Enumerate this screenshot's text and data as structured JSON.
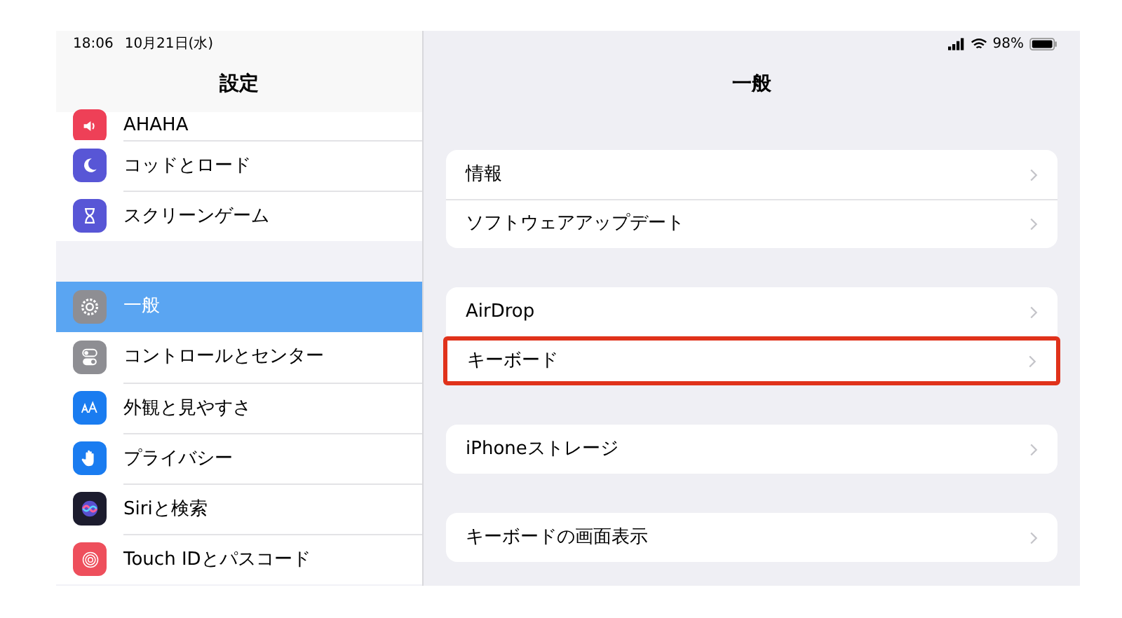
{
  "status_bar": {
    "time": "18:06",
    "date": "10月21日(水)",
    "battery": "98%"
  },
  "sidebar": {
    "title": "設定",
    "sections": [
      {
        "items": [
          {
            "label": "AHAHA",
            "kind": "sound",
            "color": "#ee4057",
            "selected": false
          },
          {
            "label": "コッドとロード",
            "kind": "moon",
            "color": "#5856d6",
            "selected": false
          },
          {
            "label": "スクリーンゲーム",
            "kind": "hourglass",
            "color": "#5856d6",
            "selected": false
          }
        ]
      },
      {
        "items": [
          {
            "label": "一般",
            "kind": "gear",
            "color": "#8e8e93",
            "selected": true
          },
          {
            "label": "コントロールとセンター",
            "kind": "toggles",
            "color": "#8e8e93",
            "selected": false
          },
          {
            "label": "外観と見やすさ",
            "kind": "text-size",
            "color": "#1a7cf0",
            "selected": false
          },
          {
            "label": "プライバシー",
            "kind": "hand",
            "color": "#1a7cf0",
            "selected": false
          },
          {
            "label": "Siriと検索",
            "kind": "siri",
            "color": "#1c1c2e",
            "selected": false
          },
          {
            "label": "Touch IDとパスコード",
            "kind": "fingerprint",
            "color": "#ee4f5c",
            "selected": false
          }
        ]
      }
    ]
  },
  "detail": {
    "title": "一般",
    "groups": [
      {
        "items": [
          {
            "label": "情報",
            "highlighted": false
          },
          {
            "label": "ソフトウェアアップデート",
            "highlighted": false
          }
        ]
      },
      {
        "items": [
          {
            "label": "AirDrop",
            "highlighted": false
          },
          {
            "label": "キーボード",
            "highlighted": true
          }
        ]
      },
      {
        "items": [
          {
            "label": "iPhoneストレージ",
            "highlighted": false
          }
        ]
      },
      {
        "items": [
          {
            "label": "キーボードの画面表示",
            "highlighted": false
          }
        ]
      }
    ]
  }
}
